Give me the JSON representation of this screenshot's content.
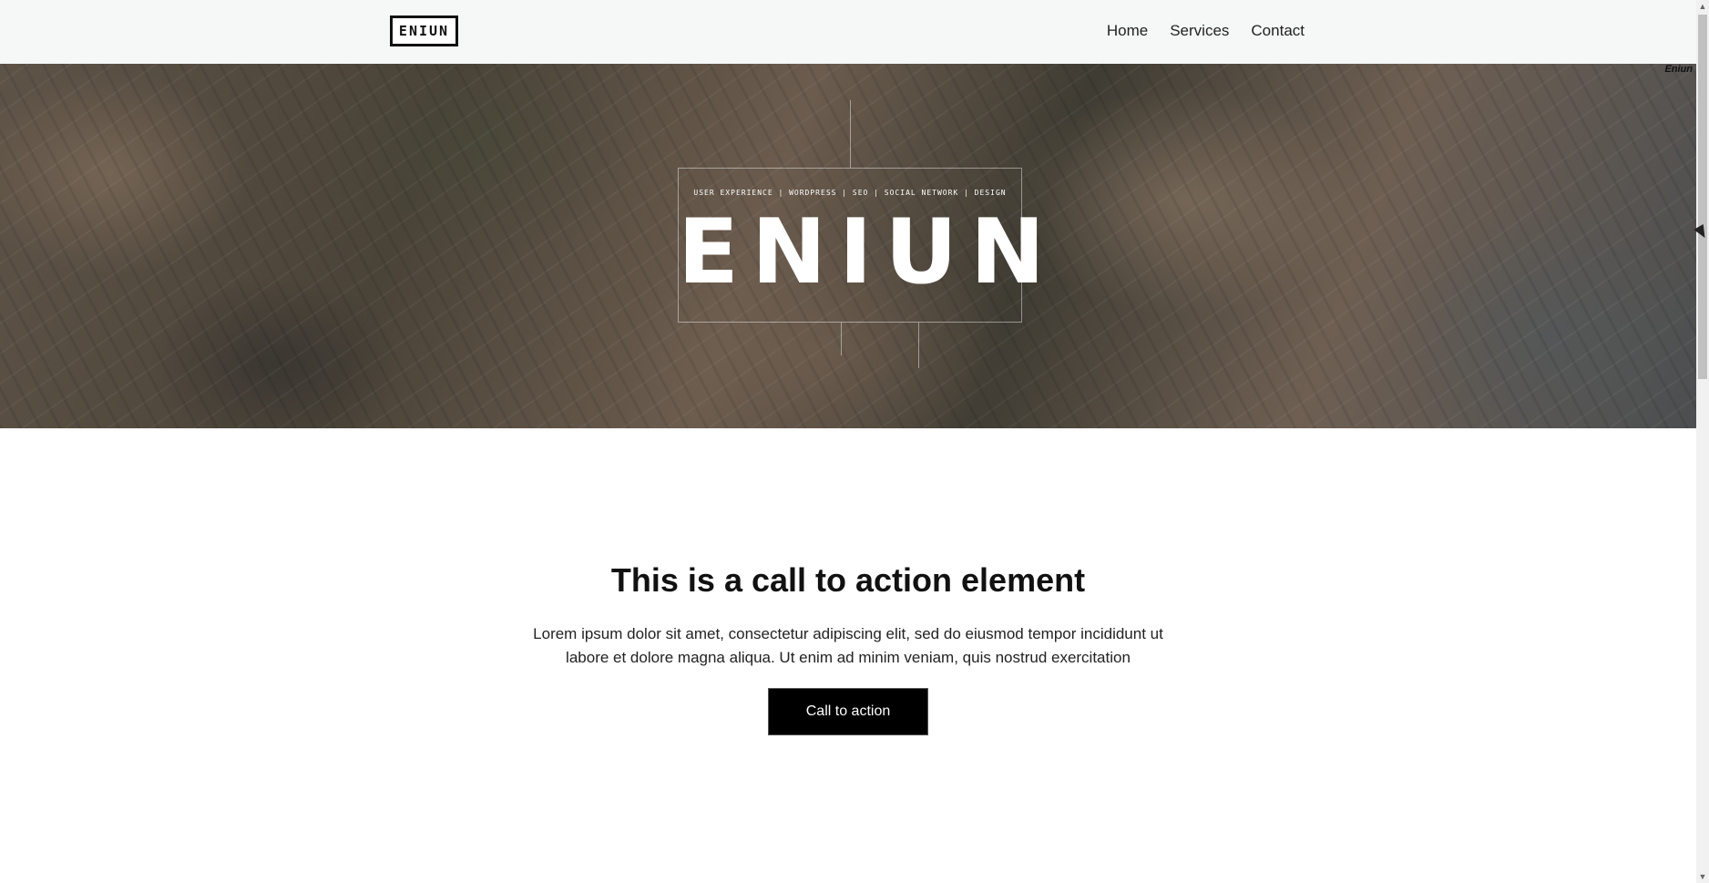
{
  "header": {
    "logo_text": "ENIUN",
    "nav": [
      {
        "label": "Home"
      },
      {
        "label": "Services"
      },
      {
        "label": "Contact"
      }
    ]
  },
  "hero": {
    "tags": "USER EXPERIENCE | WORDPRESS | SEO | SOCIAL NETWORK | DESIGN",
    "title": "ENIUN",
    "corner_text": "Eniun"
  },
  "cta": {
    "title": "This is a call to action element",
    "text": "Lorem ipsum dolor sit amet, consectetur adipiscing elit, sed do eiusmod tempor incididunt ut labore et dolore magna aliqua. Ut enim ad minim veniam, quis nostrud exercitation",
    "button_label": "Call to action"
  },
  "colors": {
    "header_bg": "#f6f7f7",
    "button_bg": "#000000",
    "text": "#111111"
  }
}
